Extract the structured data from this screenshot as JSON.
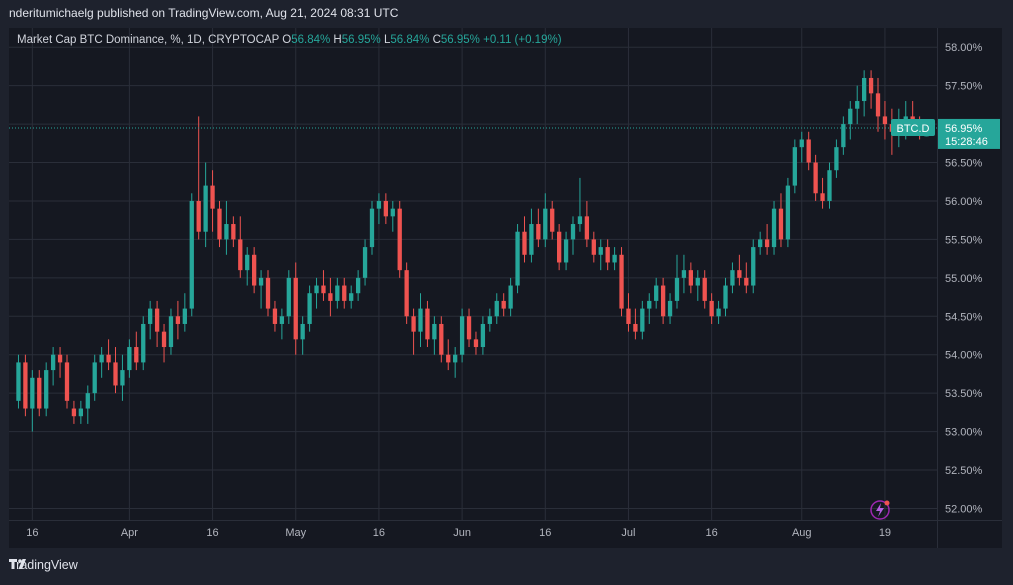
{
  "header": {
    "published_line": "nderitumichaelg published on TradingView.com, Aug 21, 2024 08:31 UTC"
  },
  "legend": {
    "symbol_text": "Market Cap BTC Dominance, %, 1D, CRYPTOCAP",
    "o_label": "O",
    "o_value": "56.84%",
    "h_label": "H",
    "h_value": "56.95%",
    "l_label": "L",
    "l_value": "56.84%",
    "c_label": "C",
    "c_value": "56.95%",
    "change": "+0.11 (+0.19%)"
  },
  "badges": {
    "symbol": "BTC.D",
    "price": "56.95%",
    "countdown": "15:28:46"
  },
  "footer": {
    "brand": "TradingView"
  },
  "colors": {
    "up": "#26a69a",
    "down": "#ef5350",
    "background": "#151821",
    "grid": "#2a2e39",
    "text": "#b2b5be"
  },
  "chart_data": {
    "type": "candlestick",
    "title": "Market Cap BTC Dominance, %, 1D, CRYPTOCAP",
    "y_unit": "%",
    "ylim": [
      51.85,
      58.25
    ],
    "y_ticks": [
      "58.00%",
      "57.50%",
      "57.00%",
      "56.50%",
      "56.00%",
      "55.50%",
      "55.00%",
      "54.50%",
      "54.00%",
      "53.50%",
      "53.00%",
      "52.50%",
      "52.00%"
    ],
    "x_ticks": [
      "16",
      "Apr",
      "16",
      "May",
      "16",
      "Jun",
      "16",
      "Jul",
      "16",
      "Aug",
      "19"
    ],
    "last_price": 56.95,
    "grid": true,
    "ohlc": [
      [
        53.4,
        54.0,
        53.3,
        53.9
      ],
      [
        53.9,
        54.0,
        53.2,
        53.3
      ],
      [
        53.3,
        53.8,
        53.0,
        53.7
      ],
      [
        53.7,
        53.8,
        53.2,
        53.3
      ],
      [
        53.3,
        53.9,
        53.2,
        53.8
      ],
      [
        53.8,
        54.1,
        53.6,
        54.0
      ],
      [
        54.0,
        54.1,
        53.7,
        53.9
      ],
      [
        53.9,
        54.0,
        53.3,
        53.4
      ],
      [
        53.3,
        53.4,
        53.1,
        53.2
      ],
      [
        53.2,
        53.4,
        53.1,
        53.3
      ],
      [
        53.3,
        53.6,
        53.1,
        53.5
      ],
      [
        53.5,
        54.0,
        53.4,
        53.9
      ],
      [
        53.9,
        54.1,
        53.7,
        54.0
      ],
      [
        54.0,
        54.2,
        53.8,
        53.9
      ],
      [
        53.9,
        54.1,
        53.5,
        53.6
      ],
      [
        53.6,
        54.0,
        53.4,
        53.8
      ],
      [
        53.8,
        54.2,
        53.7,
        54.1
      ],
      [
        54.1,
        54.3,
        53.8,
        53.9
      ],
      [
        53.9,
        54.5,
        53.8,
        54.4
      ],
      [
        54.4,
        54.7,
        54.2,
        54.6
      ],
      [
        54.6,
        54.7,
        54.1,
        54.3
      ],
      [
        54.3,
        54.4,
        53.9,
        54.1
      ],
      [
        54.1,
        54.6,
        54.0,
        54.5
      ],
      [
        54.5,
        54.7,
        54.2,
        54.4
      ],
      [
        54.4,
        54.8,
        54.3,
        54.6
      ],
      [
        54.6,
        56.1,
        54.5,
        56.0
      ],
      [
        56.0,
        57.1,
        55.5,
        55.6
      ],
      [
        55.6,
        56.5,
        55.4,
        56.2
      ],
      [
        56.2,
        56.4,
        55.6,
        55.9
      ],
      [
        55.9,
        56.0,
        55.4,
        55.5
      ],
      [
        55.5,
        56.0,
        55.3,
        55.7
      ],
      [
        55.7,
        55.8,
        55.4,
        55.5
      ],
      [
        55.5,
        55.8,
        55.0,
        55.1
      ],
      [
        55.1,
        55.4,
        54.9,
        55.3
      ],
      [
        55.3,
        55.4,
        54.8,
        54.9
      ],
      [
        54.9,
        55.1,
        54.6,
        55.0
      ],
      [
        55.0,
        55.1,
        54.5,
        54.6
      ],
      [
        54.6,
        54.7,
        54.3,
        54.4
      ],
      [
        54.4,
        54.6,
        54.2,
        54.5
      ],
      [
        54.5,
        55.1,
        54.4,
        55.0
      ],
      [
        55.0,
        55.2,
        54.0,
        54.2
      ],
      [
        54.2,
        54.5,
        54.0,
        54.4
      ],
      [
        54.4,
        54.9,
        54.3,
        54.8
      ],
      [
        54.8,
        55.0,
        54.6,
        54.9
      ],
      [
        54.9,
        55.1,
        54.7,
        54.8
      ],
      [
        54.8,
        55.0,
        54.5,
        54.7
      ],
      [
        54.7,
        55.0,
        54.6,
        54.9
      ],
      [
        54.9,
        55.0,
        54.6,
        54.7
      ],
      [
        54.7,
        54.9,
        54.6,
        54.8
      ],
      [
        54.8,
        55.1,
        54.7,
        55.0
      ],
      [
        55.0,
        55.5,
        54.9,
        55.4
      ],
      [
        55.4,
        56.0,
        55.3,
        55.9
      ],
      [
        55.9,
        56.1,
        55.7,
        56.0
      ],
      [
        56.0,
        56.1,
        55.7,
        55.8
      ],
      [
        55.8,
        56.0,
        55.6,
        55.9
      ],
      [
        55.9,
        56.0,
        55.0,
        55.1
      ],
      [
        55.1,
        55.2,
        54.4,
        54.5
      ],
      [
        54.5,
        54.6,
        54.0,
        54.3
      ],
      [
        54.3,
        54.8,
        54.1,
        54.6
      ],
      [
        54.6,
        54.7,
        54.1,
        54.2
      ],
      [
        54.2,
        54.5,
        54.0,
        54.4
      ],
      [
        54.4,
        54.5,
        53.9,
        54.0
      ],
      [
        54.0,
        54.2,
        53.8,
        53.9
      ],
      [
        53.9,
        54.1,
        53.7,
        54.0
      ],
      [
        54.0,
        54.6,
        53.9,
        54.5
      ],
      [
        54.5,
        54.6,
        54.1,
        54.2
      ],
      [
        54.2,
        54.3,
        54.0,
        54.1
      ],
      [
        54.1,
        54.5,
        54.0,
        54.4
      ],
      [
        54.4,
        54.6,
        54.3,
        54.5
      ],
      [
        54.5,
        54.8,
        54.4,
        54.7
      ],
      [
        54.7,
        54.8,
        54.5,
        54.6
      ],
      [
        54.6,
        55.0,
        54.5,
        54.9
      ],
      [
        54.9,
        55.7,
        54.8,
        55.6
      ],
      [
        55.6,
        55.8,
        55.2,
        55.3
      ],
      [
        55.3,
        55.9,
        55.2,
        55.7
      ],
      [
        55.7,
        55.9,
        55.4,
        55.5
      ],
      [
        55.5,
        56.1,
        55.4,
        55.9
      ],
      [
        55.9,
        56.0,
        55.5,
        55.6
      ],
      [
        55.6,
        55.7,
        55.1,
        55.2
      ],
      [
        55.2,
        55.6,
        55.1,
        55.5
      ],
      [
        55.5,
        55.8,
        55.3,
        55.7
      ],
      [
        55.7,
        56.3,
        55.6,
        55.8
      ],
      [
        55.8,
        56.0,
        55.4,
        55.5
      ],
      [
        55.5,
        55.6,
        55.2,
        55.3
      ],
      [
        55.3,
        55.5,
        55.1,
        55.4
      ],
      [
        55.4,
        55.5,
        55.1,
        55.2
      ],
      [
        55.2,
        55.4,
        55.1,
        55.3
      ],
      [
        55.3,
        55.4,
        54.5,
        54.6
      ],
      [
        54.6,
        54.8,
        54.3,
        54.4
      ],
      [
        54.4,
        54.6,
        54.2,
        54.3
      ],
      [
        54.3,
        54.7,
        54.2,
        54.6
      ],
      [
        54.6,
        54.8,
        54.4,
        54.7
      ],
      [
        54.7,
        55.0,
        54.6,
        54.9
      ],
      [
        54.9,
        55.0,
        54.4,
        54.5
      ],
      [
        54.5,
        54.8,
        54.4,
        54.7
      ],
      [
        54.7,
        55.3,
        54.6,
        55.0
      ],
      [
        55.0,
        55.3,
        54.8,
        55.1
      ],
      [
        55.1,
        55.2,
        54.8,
        54.9
      ],
      [
        54.9,
        55.1,
        54.7,
        55.0
      ],
      [
        55.0,
        55.1,
        54.6,
        54.7
      ],
      [
        54.7,
        54.8,
        54.4,
        54.5
      ],
      [
        54.5,
        54.7,
        54.4,
        54.6
      ],
      [
        54.6,
        55.0,
        54.5,
        54.9
      ],
      [
        54.9,
        55.2,
        54.8,
        55.1
      ],
      [
        55.1,
        55.3,
        54.9,
        55.0
      ],
      [
        55.0,
        55.2,
        54.8,
        54.9
      ],
      [
        54.9,
        55.5,
        54.8,
        55.4
      ],
      [
        55.4,
        55.6,
        55.3,
        55.5
      ],
      [
        55.5,
        55.7,
        55.3,
        55.4
      ],
      [
        55.4,
        56.0,
        55.3,
        55.9
      ],
      [
        55.9,
        56.1,
        55.4,
        55.5
      ],
      [
        55.5,
        56.3,
        55.4,
        56.2
      ],
      [
        56.2,
        56.8,
        56.1,
        56.7
      ],
      [
        56.7,
        56.9,
        56.5,
        56.8
      ],
      [
        56.8,
        56.9,
        56.4,
        56.5
      ],
      [
        56.5,
        56.6,
        56.0,
        56.1
      ],
      [
        56.1,
        56.3,
        55.9,
        56.0
      ],
      [
        56.0,
        56.5,
        55.9,
        56.4
      ],
      [
        56.4,
        56.8,
        56.3,
        56.7
      ],
      [
        56.7,
        57.1,
        56.6,
        57.0
      ],
      [
        57.0,
        57.3,
        56.8,
        57.2
      ],
      [
        57.2,
        57.5,
        57.0,
        57.3
      ],
      [
        57.3,
        57.7,
        57.1,
        57.6
      ],
      [
        57.6,
        57.7,
        57.2,
        57.4
      ],
      [
        57.4,
        57.6,
        56.9,
        57.1
      ],
      [
        57.1,
        57.3,
        56.8,
        57.0
      ],
      [
        57.0,
        57.2,
        56.6,
        56.9
      ],
      [
        56.9,
        57.2,
        56.7,
        57.0
      ],
      [
        57.0,
        57.3,
        56.8,
        57.1
      ],
      [
        57.1,
        57.3,
        56.9,
        57.0
      ],
      [
        57.0,
        57.1,
        56.8,
        56.9
      ],
      [
        56.84,
        56.95,
        56.84,
        56.95
      ]
    ]
  }
}
